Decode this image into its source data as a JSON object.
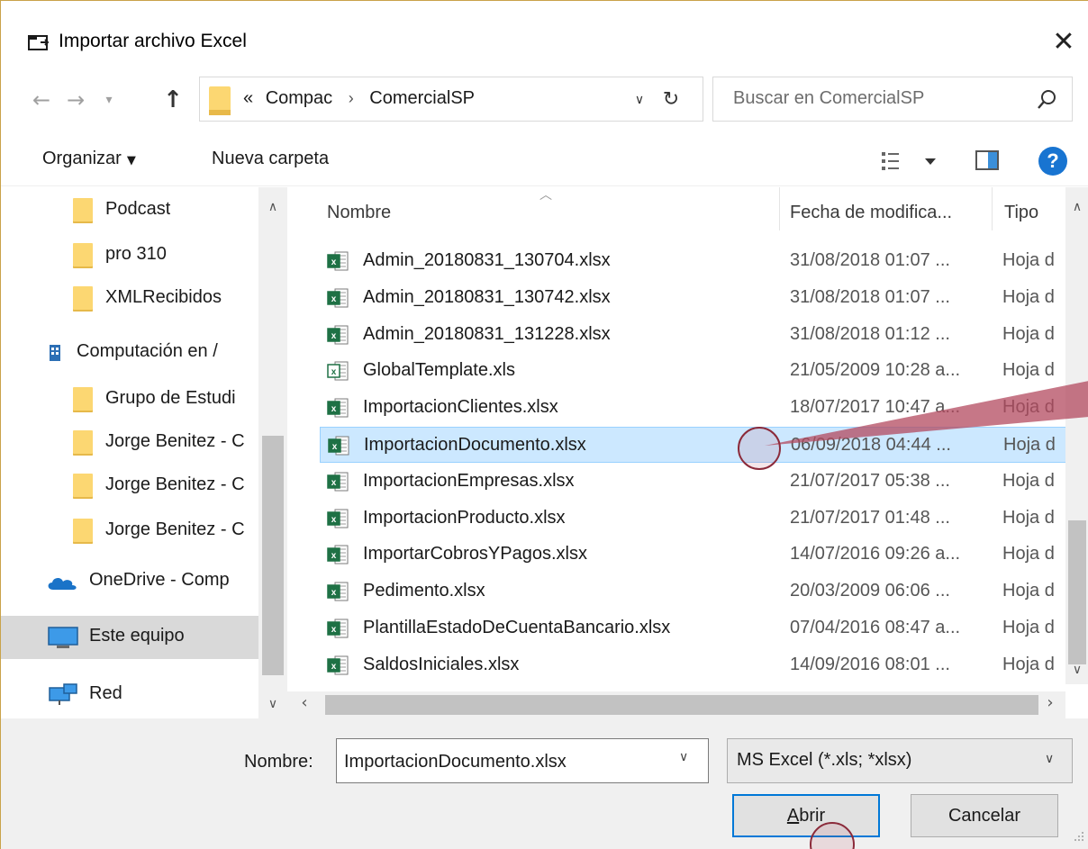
{
  "window": {
    "title": "Importar archivo Excel",
    "close_glyph": "✕"
  },
  "address": {
    "overflow": "«",
    "crumbs": [
      "Compac",
      "ComercialSP"
    ],
    "separator": "›"
  },
  "search": {
    "placeholder": "Buscar en ComercialSP"
  },
  "toolbar": {
    "organize_label": "Organizar",
    "new_folder_label": "Nueva carpeta",
    "help_glyph": "?"
  },
  "nav_pane": {
    "items": [
      {
        "label": "Podcast",
        "icon": "folder-icon"
      },
      {
        "label": "pro 310",
        "icon": "folder-icon"
      },
      {
        "label": "XMLRecibidos",
        "icon": "folder-icon"
      },
      {
        "label": "Computación en /",
        "icon": "building-icon"
      },
      {
        "label": "Grupo de Estudi",
        "icon": "folder-icon"
      },
      {
        "label": "Jorge Benitez - C",
        "icon": "folder-icon"
      },
      {
        "label": "Jorge Benitez - C",
        "icon": "folder-icon"
      },
      {
        "label": "Jorge Benitez - C",
        "icon": "folder-icon"
      },
      {
        "label": "OneDrive - Comp",
        "icon": "onedrive-icon"
      },
      {
        "label": "Este equipo",
        "icon": "computer-icon",
        "selected": true
      },
      {
        "label": "Red",
        "icon": "network-icon"
      }
    ]
  },
  "file_list": {
    "columns": {
      "name": "Nombre",
      "date": "Fecha de modifica...",
      "type": "Tipo"
    },
    "rows": [
      {
        "name": "Admin_20180831_130704.xlsx",
        "date": "31/08/2018 01:07 ...",
        "type": "Hoja d"
      },
      {
        "name": "Admin_20180831_130742.xlsx",
        "date": "31/08/2018 01:07 ...",
        "type": "Hoja d"
      },
      {
        "name": "Admin_20180831_131228.xlsx",
        "date": "31/08/2018 01:12 ...",
        "type": "Hoja d"
      },
      {
        "name": "GlobalTemplate.xls",
        "date": "21/05/2009 10:28 a...",
        "type": "Hoja d"
      },
      {
        "name": "ImportacionClientes.xlsx",
        "date": "18/07/2017 10:47 a...",
        "type": "Hoja d"
      },
      {
        "name": "ImportacionDocumento.xlsx",
        "date": "06/09/2018 04:44 ...",
        "type": "Hoja d",
        "selected": true
      },
      {
        "name": "ImportacionEmpresas.xlsx",
        "date": "21/07/2017 05:38 ...",
        "type": "Hoja d"
      },
      {
        "name": "ImportacionProducto.xlsx",
        "date": "21/07/2017 01:48 ...",
        "type": "Hoja d"
      },
      {
        "name": "ImportarCobrosYPagos.xlsx",
        "date": "14/07/2016 09:26 a...",
        "type": "Hoja d"
      },
      {
        "name": "Pedimento.xlsx",
        "date": "20/03/2009 06:06 ...",
        "type": "Hoja d"
      },
      {
        "name": "PlantillaEstadoDeCuentaBancario.xlsx",
        "date": "07/04/2016 08:47 a...",
        "type": "Hoja d"
      },
      {
        "name": "SaldosIniciales.xlsx",
        "date": "14/09/2016 08:01 ...",
        "type": "Hoja d"
      }
    ]
  },
  "bottom": {
    "name_label": "Nombre:",
    "name_value": "ImportacionDocumento.xlsx",
    "filter_value": "MS Excel (*.xls; *xlsx)",
    "open_label_first": "A",
    "open_label_rest": "brir",
    "cancel_label": "Cancelar"
  },
  "colors": {
    "selection_bg": "#cce8ff",
    "selection_border": "#99d1ff",
    "accent": "#0078d7",
    "folder": "#fcd772",
    "excel_green": "#1e7145",
    "annotation": "#8b2a3a"
  }
}
